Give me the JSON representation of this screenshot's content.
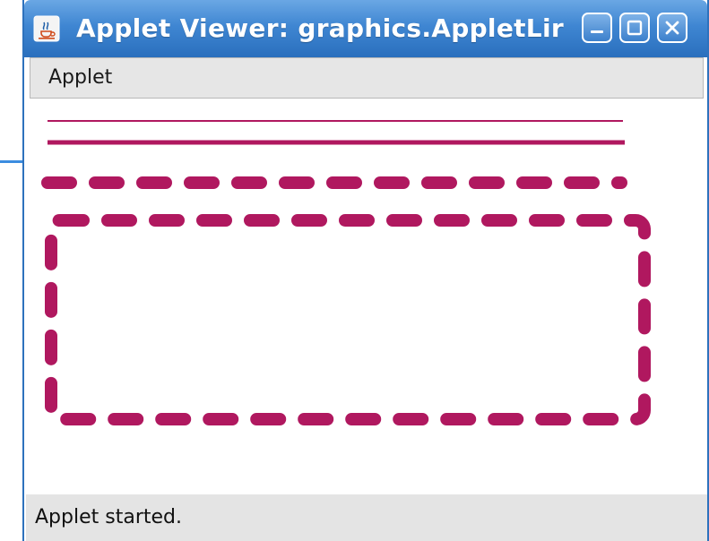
{
  "window": {
    "title": "Applet Viewer: graphics.AppletLir",
    "icon": "java-cup-icon",
    "controls": [
      "minimize-icon",
      "maximize-icon",
      "close-icon"
    ]
  },
  "menubar": {
    "items": [
      {
        "label": "Applet"
      }
    ]
  },
  "canvas": {
    "stroke_color": "#b0185f",
    "shapes": [
      "thin-line",
      "medium-line",
      "dashed-line",
      "dashed-rounded-rectangle"
    ]
  },
  "status": {
    "text": "Applet started."
  },
  "colors": {
    "titlebar": "#3f86d2",
    "shape": "#b0185f",
    "status_bg": "#e4e4e4",
    "menu_bg": "#e6e6e6"
  }
}
